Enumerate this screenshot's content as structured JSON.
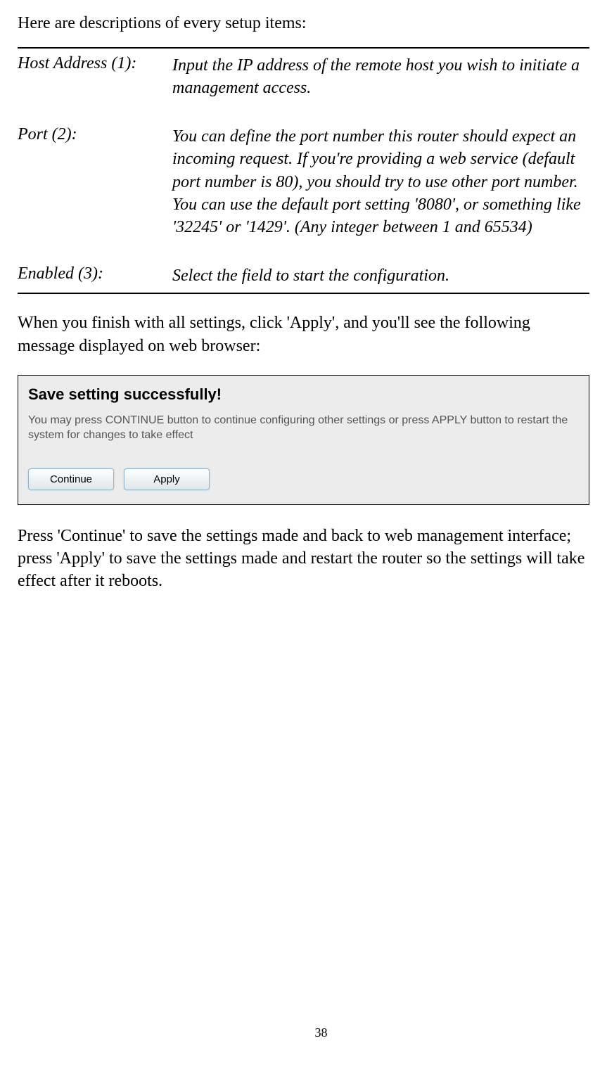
{
  "intro": "Here are descriptions of every setup items:",
  "definitions": [
    {
      "term": "Host Address (1):",
      "desc": "Input the IP address of the remote host you wish to initiate a management access."
    },
    {
      "term": "Port (2):",
      "desc": "You can define the port number this router should expect an incoming request. If you're providing a web service (default port number is 80), you should try to use other port number. You can use the default port setting '8080', or something like '32245' or '1429'. (Any integer between 1 and 65534)"
    },
    {
      "term": "Enabled (3):",
      "desc": "Select the field to start the configuration."
    }
  ],
  "post_text": "When you finish with all settings, click 'Apply', and you'll see the following message displayed on web browser:",
  "dialog": {
    "title": "Save setting successfully!",
    "desc": "You may press CONTINUE button to continue configuring other settings or press APPLY button to restart the system for changes to take effect",
    "continue_label": "Continue",
    "apply_label": "Apply"
  },
  "final_text": "Press 'Continue' to save the settings made and back to web management interface; press 'Apply' to save the settings made and restart the router so the settings will take effect after it reboots.",
  "page_number": "38"
}
